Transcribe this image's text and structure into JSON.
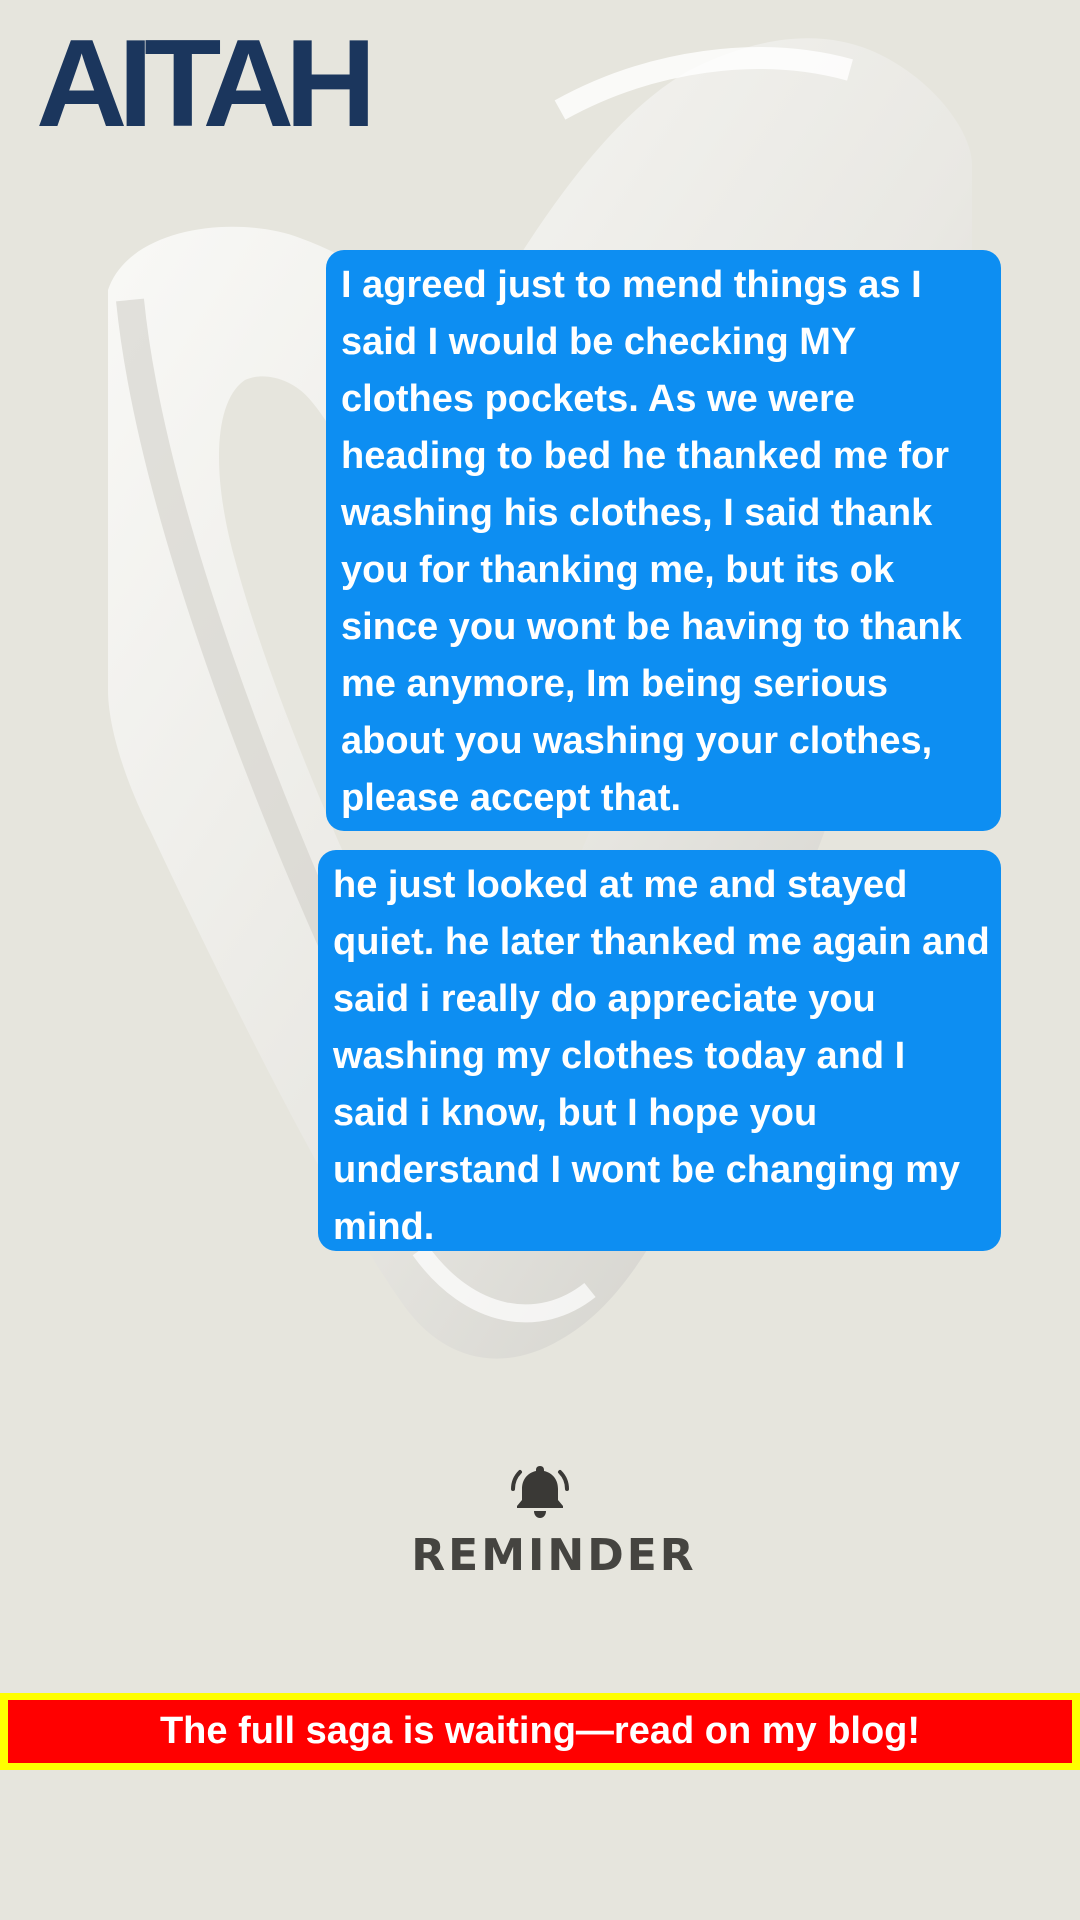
{
  "logo": {
    "text": "AITAH"
  },
  "messages": [
    {
      "text": "I agreed just to mend things as I said I would be checking MY clothes pockets. As we were heading to bed he thanked me for washing his clothes, I said thank you for thanking me, but its ok since you wont be having to thank me anymore, Im being serious about you washing your clothes, please accept that."
    },
    {
      "text": "he just looked at me and stayed quiet. he later thanked me again and said i really do appreciate you washing my clothes today and I said i know, but I hope you understand I wont be changing my mind."
    }
  ],
  "reminder": {
    "icon": "bell-icon",
    "label": "REMINDER"
  },
  "cta": {
    "text": "The full saga is waiting—read on my blog!"
  },
  "colors": {
    "background": "#e6e5dd",
    "logo": "#1b365d",
    "bubble": "#0d8ef2",
    "reminder_text": "#454440",
    "cta_border": "#ffff00",
    "cta_fill": "#ff0000"
  }
}
